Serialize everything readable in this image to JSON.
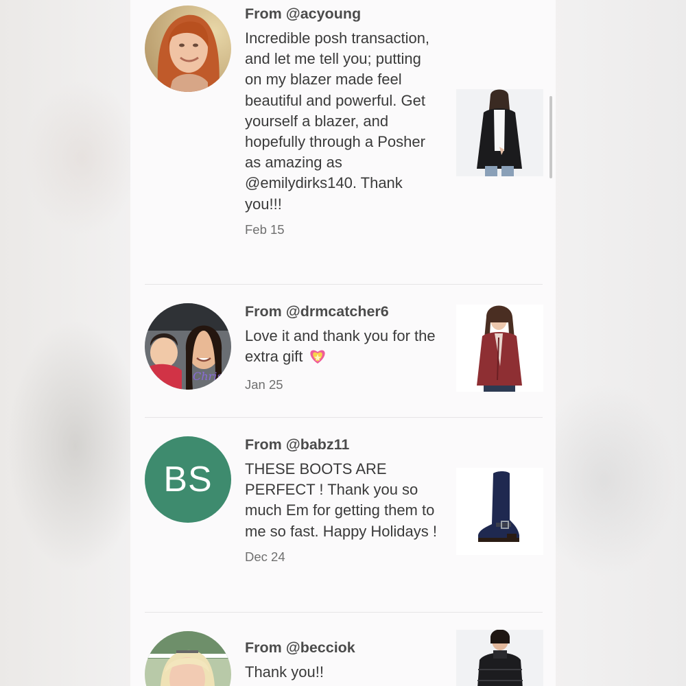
{
  "reviews": [
    {
      "from": "From @acyoung",
      "message": "Incredible posh transaction, and let me tell you; putting on my blazer made feel beautiful and powerful. Get yourself a blazer, and hopefully through a Posher as amazing as @emilydirks140. Thank you!!!",
      "date": "Feb 15",
      "item_icon": "black-blazer"
    },
    {
      "from": "From @drmcatcher6",
      "message": "Love it and thank you for the extra gift",
      "emoji": "sparkling-heart-icon",
      "date": "Jan 25",
      "item_icon": "burgundy-leather-jacket"
    },
    {
      "from": "From @babz11",
      "initials": "BS",
      "message": "THESE BOOTS ARE PERFECT ! Thank you so much Em for getting them to me so fast. Happy Holidays !",
      "date": "Dec 24",
      "item_icon": "navy-riding-boot"
    },
    {
      "from": "From @becciok",
      "message": "Thank you!!",
      "item_icon": "black-puffer-jacket"
    }
  ],
  "colors": {
    "initials_avatar": "#3e8b6e",
    "panel": "#fbfafb",
    "divider": "#e6e4e6"
  }
}
